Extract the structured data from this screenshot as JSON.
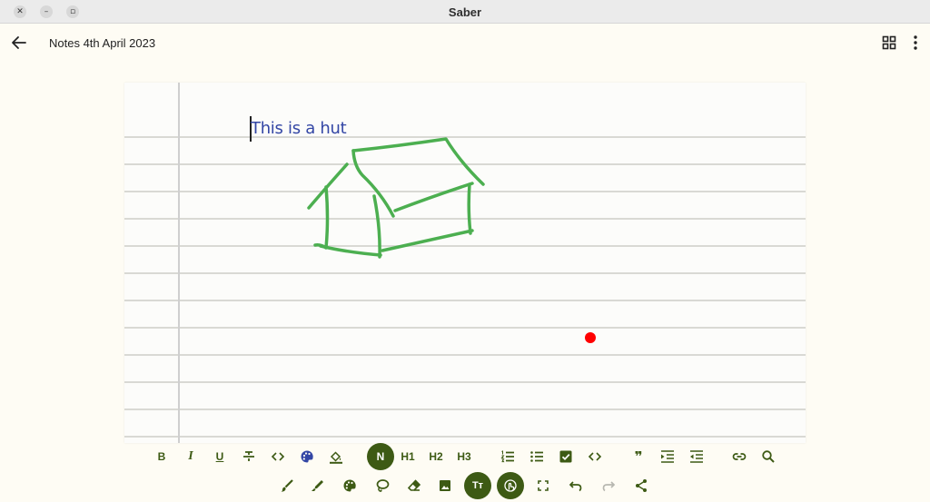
{
  "window": {
    "title": "Saber",
    "close_glyph": "✕",
    "minimize_glyph": "–",
    "maximize_glyph": "▫"
  },
  "appbar": {
    "note_title": "Notes 4th April 2023",
    "back_icon": "arrow-left-icon",
    "layout_icon": "grid-view-icon",
    "more_icon": "more-vertical-icon"
  },
  "note": {
    "text": "This is a hut"
  },
  "colors": {
    "accent": "#3d5a14",
    "ink_green": "#4caf50",
    "text_blue": "#3346a5",
    "pen_dot": "#ff0000",
    "page_lines": "#d9d9d4",
    "margin_line": "#cfcfcf"
  },
  "format_toolbar": {
    "bold": "B",
    "italic": "I",
    "underline": "U",
    "normal": "N",
    "h1": "H1",
    "h2": "H2",
    "h3": "H3",
    "quote": "❞"
  },
  "tools_toolbar": {
    "text_tool": "Tт"
  }
}
